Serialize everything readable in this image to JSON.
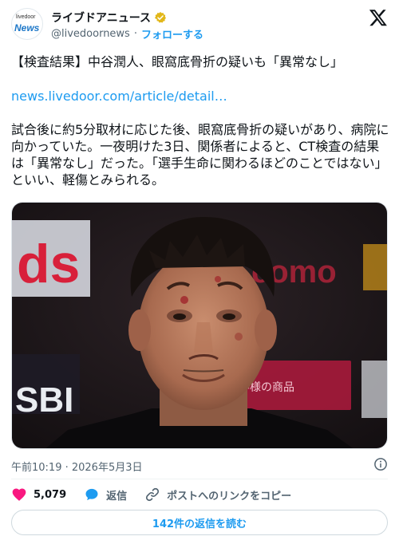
{
  "account": {
    "avatar_text_small": "livedoor",
    "avatar_text_big": "News",
    "name": "ライブドアニュース",
    "handle": "@livedoornews",
    "separator": "·",
    "follow_label": "フォローする"
  },
  "tweet": {
    "headline": "【検査結果】中谷潤人、眼窩底骨折の疑いも「異常なし」",
    "link": "news.livedoor.com/article/detail…",
    "body": "試合後に約5分取材に応じた後、眼窩底骨折の疑いがあり、病院に向かっていた。一夜明けた3日、関係者によると、CT検査の結果は「異常なし」だった。「選手生命に関わるほどのことではない」といい、軽傷とみられる。",
    "timestamp": "午前10:19 · 2026年5月3日"
  },
  "photo": {
    "backdrop_text_left": "ds",
    "backdrop_text_right": "como",
    "backdrop_text_bottom_left": "SBI",
    "backdrop_banner": "お客様の商品 "
  },
  "actions": {
    "likes_count": "5,079",
    "reply_label": "返信",
    "copy_link_label": "ポストへのリンクをコピー",
    "read_replies_label": "142件の返信を読む"
  },
  "colors": {
    "accent": "#1d9bf0",
    "like": "#f91880",
    "verified": "#e2b719",
    "secondary_text": "#536471"
  },
  "icons": {
    "verified": "verified-badge-icon",
    "x_logo": "x-logo-icon",
    "info": "info-icon",
    "heart": "heart-icon",
    "reply": "reply-bubble-icon",
    "link": "link-icon"
  }
}
